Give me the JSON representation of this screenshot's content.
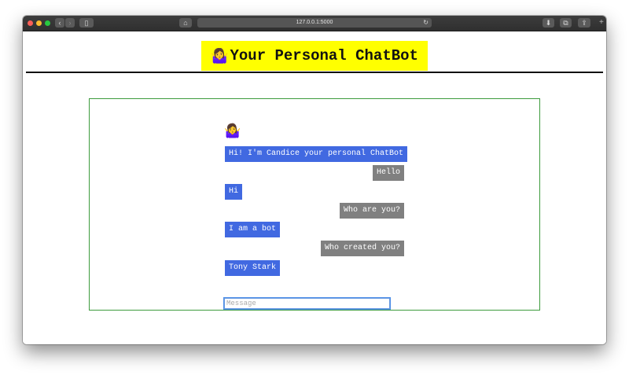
{
  "browser": {
    "url": "127.0.0.1:5000"
  },
  "header": {
    "emoji": "🤷‍♀️",
    "title": "Your Personal ChatBot",
    "background": "#ffff00"
  },
  "chat": {
    "bot_avatar": "🤷‍♀️",
    "messages": [
      {
        "from": "bot",
        "text": "Hi! I'm Candice your personal ChatBot"
      },
      {
        "from": "user",
        "text": "Hello"
      },
      {
        "from": "bot",
        "text": "Hi"
      },
      {
        "from": "user",
        "text": "Who are you?"
      },
      {
        "from": "bot",
        "text": "I am a bot"
      },
      {
        "from": "user",
        "text": "Who created you?"
      },
      {
        "from": "bot",
        "text": "Tony Stark"
      }
    ],
    "bot_color": "#4169e1",
    "user_color": "#808080",
    "input_placeholder": "Message"
  }
}
